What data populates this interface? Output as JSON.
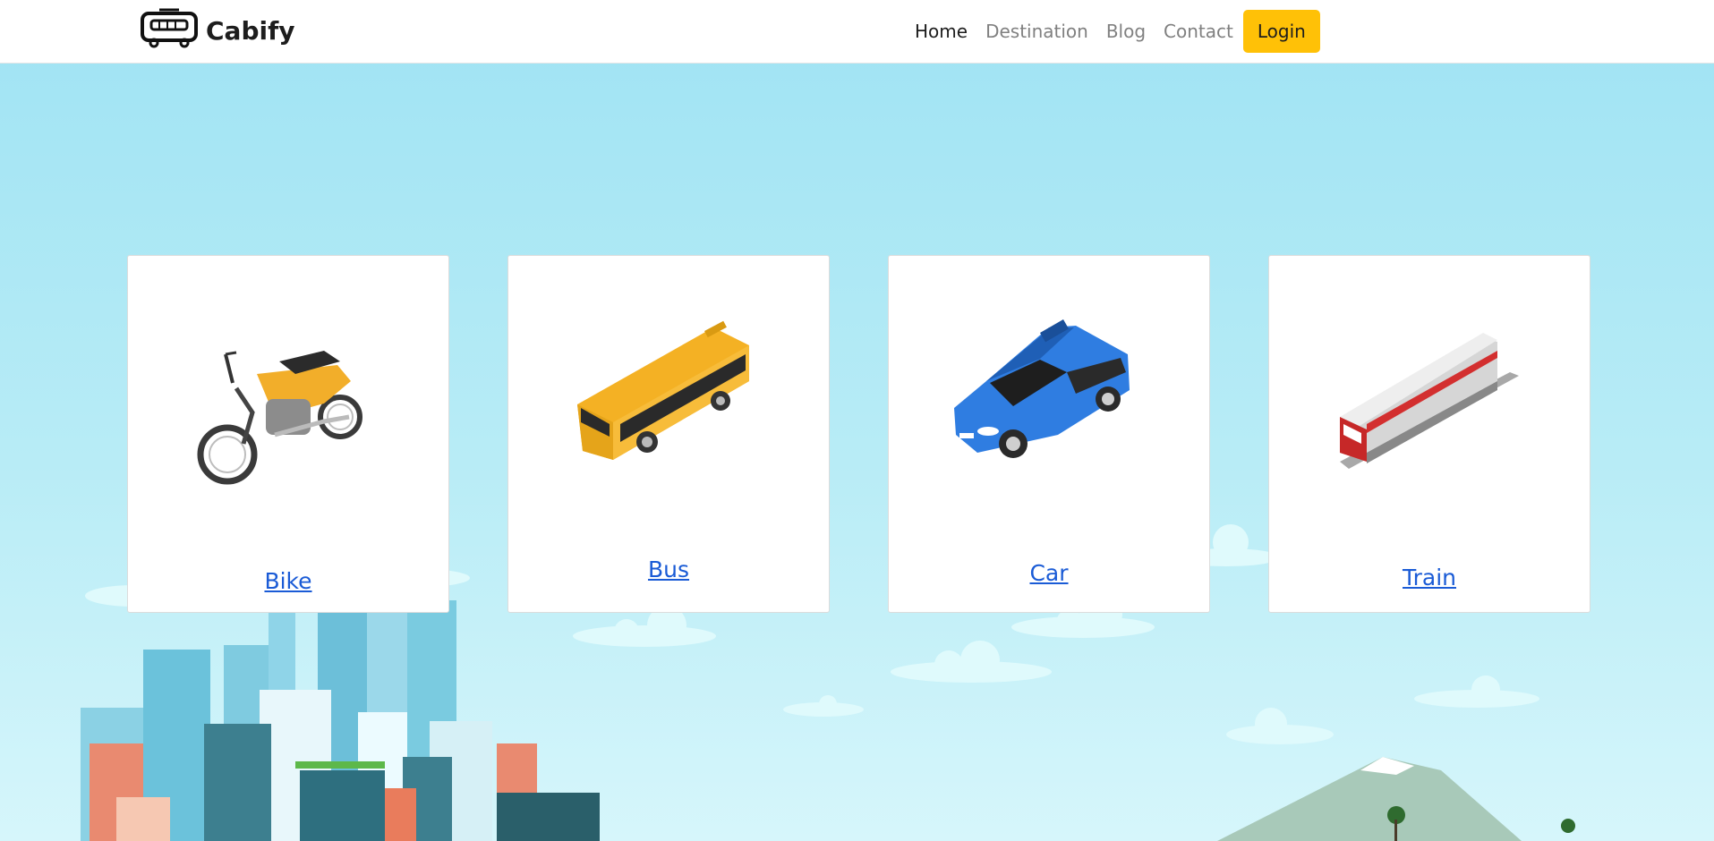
{
  "brand": {
    "name": "Cabify",
    "icon": "bus-logo-icon"
  },
  "nav": {
    "items": [
      {
        "label": "Home",
        "active": true
      },
      {
        "label": "Destination",
        "active": false
      },
      {
        "label": "Blog",
        "active": false
      },
      {
        "label": "Contact",
        "active": false
      }
    ],
    "login_label": "Login",
    "login_color": "#ffc107"
  },
  "cards": [
    {
      "label": "Bike",
      "icon": "motorcycle-icon"
    },
    {
      "label": "Bus",
      "icon": "bus-icon"
    },
    {
      "label": "Car",
      "icon": "car-icon"
    },
    {
      "label": "Train",
      "icon": "train-icon"
    }
  ],
  "colors": {
    "sky": "#9fe3f3",
    "link": "#1a5bd6",
    "accent": "#ffc107"
  }
}
